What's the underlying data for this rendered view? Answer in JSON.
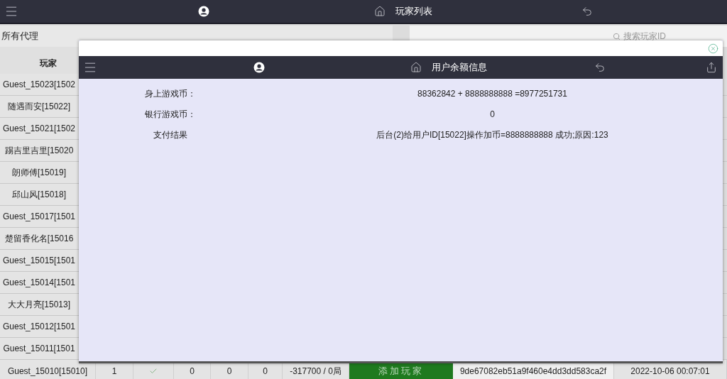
{
  "top_bar": {
    "title": "玩家列表"
  },
  "agent_panel": {
    "label": "所有代理"
  },
  "search": {
    "placeholder": "搜索玩家ID"
  },
  "table": {
    "columns": [
      "玩家"
    ],
    "rows": [
      {
        "player": "Guest_15023[1502"
      },
      {
        "player": "随遇而安[15022]"
      },
      {
        "player": "Guest_15021[1502"
      },
      {
        "player": "踢吉里吉里[15020"
      },
      {
        "player": "朗师傅[15019]"
      },
      {
        "player": "邱山风[15018]"
      },
      {
        "player": "Guest_15017[1501"
      },
      {
        "player": "楚留香化名[15016"
      },
      {
        "player": "Guest_15015[1501"
      },
      {
        "player": "Guest_15014[1501"
      },
      {
        "player": "大大月亮[15013]"
      },
      {
        "player": "Guest_15012[1501"
      },
      {
        "player": "Guest_15011[1501"
      }
    ],
    "last_row": {
      "player": "Guest_15010[15010]",
      "column_2": "1",
      "checked": true,
      "column_4": "0",
      "column_5": "0",
      "column_6": "0",
      "column_7": "-317700 / 0局",
      "button": "添加玩家",
      "column_9": "9de67082eb51a9f460e4dd3dd583ca2f",
      "column_10": "2022-10-06 00:07:01"
    }
  },
  "dialog": {
    "title": "用户余额信息",
    "rows": [
      {
        "label": "身上游戏币：",
        "value": "88362842 + 8888888888 =8977251731"
      },
      {
        "label": "银行游戏币：",
        "value": "0"
      },
      {
        "label": "支付结果",
        "value": "后台(2)给用户ID[15022]操作加币=8888888888 成功;原因:123"
      }
    ]
  }
}
